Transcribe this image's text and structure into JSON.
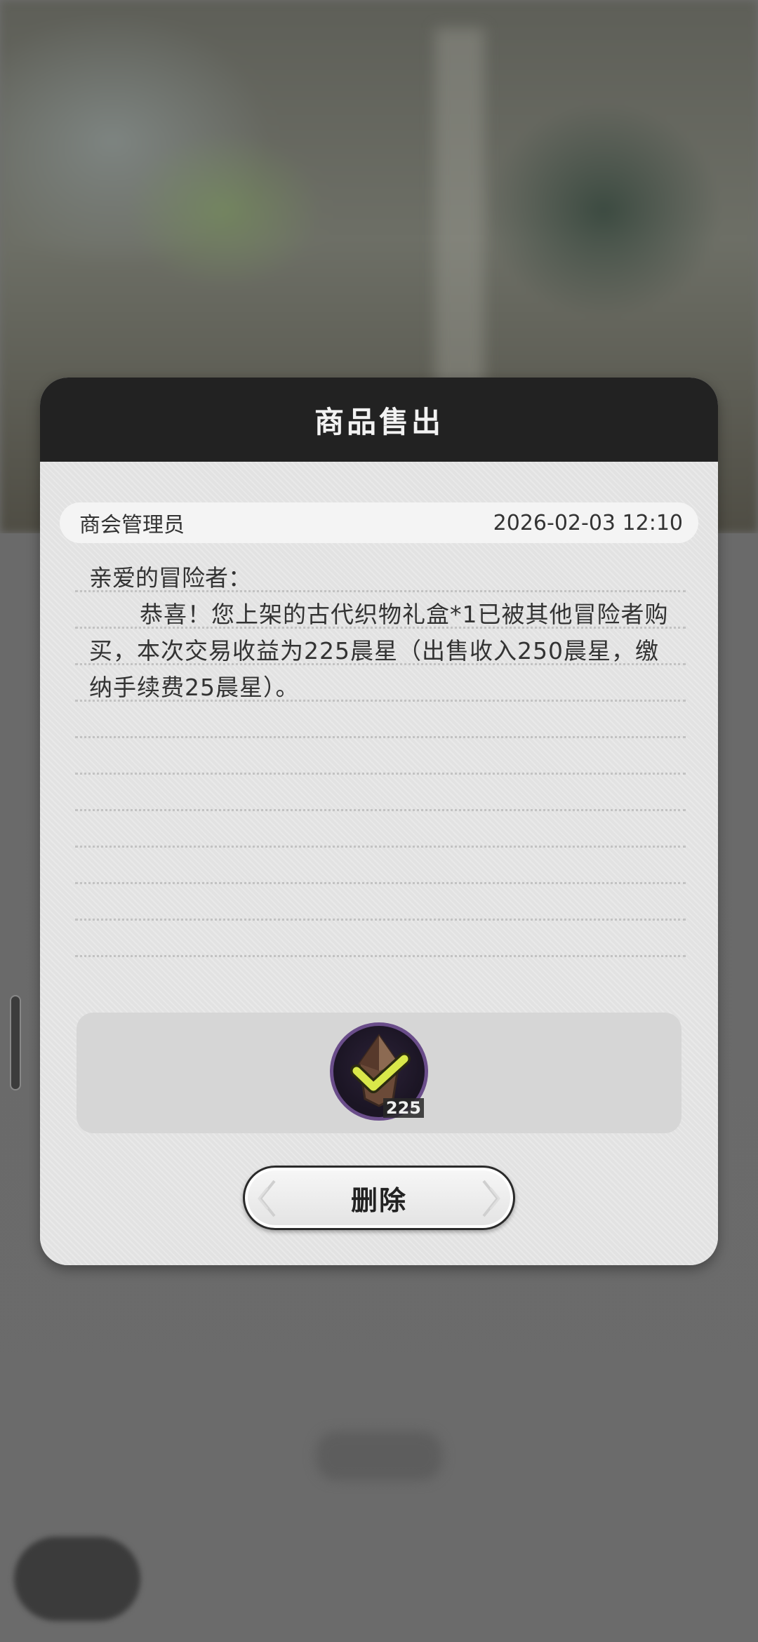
{
  "dialog": {
    "title": "商品售出",
    "sender": "商会管理员",
    "timestamp": "2026-02-03 12:10",
    "greeting": "亲爱的冒险者：",
    "content": "恭喜！您上架的古代织物礼盒*1已被其他冒险者购买，本次交易收益为225晨星（出售收入250晨星，缴纳手续费25晨星）。",
    "reward": {
      "icon": "morning-star-currency-icon",
      "count": "225"
    },
    "delete_label": "删除"
  },
  "colors": {
    "header": "#222222",
    "body": "#e2e2e2",
    "reward_border": "#6a4d8a",
    "reward_icon": "#d9e84a"
  }
}
